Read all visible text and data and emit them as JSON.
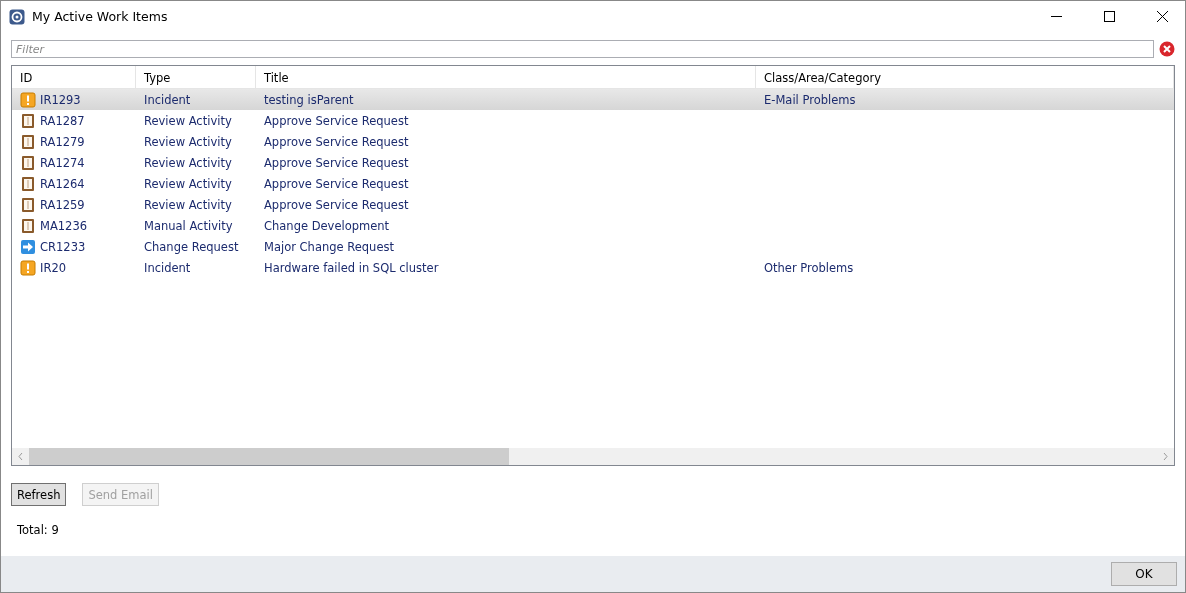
{
  "window": {
    "title": "My Active Work Items"
  },
  "filter": {
    "placeholder": "Filter"
  },
  "table": {
    "columns": [
      "ID",
      "Type",
      "Title",
      "Class/Area/Category"
    ],
    "rows": [
      {
        "kind": "incident",
        "selected": true,
        "cells": [
          "IR1293",
          "Incident",
          "testing isParent",
          "E-Mail Problems"
        ]
      },
      {
        "kind": "review",
        "selected": false,
        "cells": [
          "RA1287",
          "Review Activity",
          "Approve Service Request",
          ""
        ]
      },
      {
        "kind": "review",
        "selected": false,
        "cells": [
          "RA1279",
          "Review Activity",
          "Approve Service Request",
          ""
        ]
      },
      {
        "kind": "review",
        "selected": false,
        "cells": [
          "RA1274",
          "Review Activity",
          "Approve Service Request",
          ""
        ]
      },
      {
        "kind": "review",
        "selected": false,
        "cells": [
          "RA1264",
          "Review Activity",
          "Approve Service Request",
          ""
        ]
      },
      {
        "kind": "review",
        "selected": false,
        "cells": [
          "RA1259",
          "Review Activity",
          "Approve Service Request",
          ""
        ]
      },
      {
        "kind": "manual",
        "selected": false,
        "cells": [
          "MA1236",
          "Manual Activity",
          "Change Development",
          ""
        ]
      },
      {
        "kind": "change",
        "selected": false,
        "cells": [
          "CR1233",
          "Change Request",
          "Major Change Request",
          ""
        ]
      },
      {
        "kind": "incident",
        "selected": false,
        "cells": [
          "IR20",
          "Incident",
          "Hardware failed in SQL cluster",
          "Other Problems"
        ]
      }
    ]
  },
  "buttons": [
    {
      "label": "Refresh",
      "disabled": false
    },
    {
      "label": "Send Email",
      "disabled": true
    }
  ],
  "total": "Total: 9",
  "footer_button": "OK"
}
